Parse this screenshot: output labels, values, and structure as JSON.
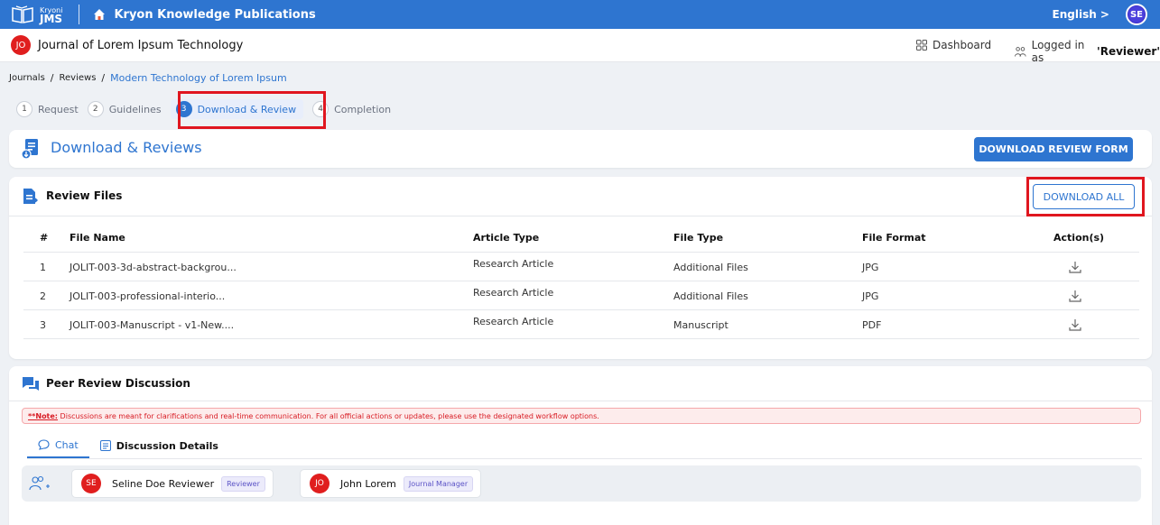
{
  "app": {
    "brand_small": "Kryoni",
    "brand_big": "JMS",
    "publisher": "Kryon Knowledge Publications",
    "language": "English >",
    "user_initials": "SE"
  },
  "journal": {
    "initials": "JO",
    "title": "Journal of Lorem Ipsum Technology",
    "dashboard_label": "Dashboard",
    "logged_prefix": "Logged in as",
    "logged_role": "'Reviewer'"
  },
  "breadcrumb": {
    "items": [
      "Journals",
      "Reviews"
    ],
    "separator": "/",
    "current": "Modern Technology of Lorem Ipsum"
  },
  "stepper": [
    {
      "num": "1",
      "label": "Request"
    },
    {
      "num": "2",
      "label": "Guidelines"
    },
    {
      "num": "3",
      "label": "Download & Review"
    },
    {
      "num": "4",
      "label": "Completion"
    }
  ],
  "download_section": {
    "title": "Download & Reviews",
    "button": "DOWNLOAD REVIEW FORM"
  },
  "review_files": {
    "title": "Review Files",
    "download_all": "DOWNLOAD ALL",
    "columns": [
      "#",
      "File Name",
      "Article Type",
      "File Type",
      "File Format",
      "Action(s)"
    ],
    "rows": [
      {
        "num": "1",
        "name": "JOLIT-003-3d-abstract-backgrou...",
        "article_type": "Research Article",
        "file_type": "Additional Files",
        "format": "JPG"
      },
      {
        "num": "2",
        "name": "JOLIT-003-professional-interio...",
        "article_type": "Research Article",
        "file_type": "Additional Files",
        "format": "JPG"
      },
      {
        "num": "3",
        "name": "JOLIT-003-Manuscript - v1-New....",
        "article_type": "Research Article",
        "file_type": "Manuscript",
        "format": "PDF"
      }
    ]
  },
  "discussion": {
    "title": "Peer Review Discussion",
    "note_prefix": "**Note:",
    "note_text": " Discussions are meant for clarifications and real-time communication. For all official actions or updates, please use the designated workflow options.",
    "tabs": [
      "Chat",
      "Discussion Details"
    ],
    "participants": [
      {
        "initials": "SE",
        "name": "Seline Doe Reviewer",
        "role": "Reviewer"
      },
      {
        "initials": "JO",
        "name": "John Lorem",
        "role": "Journal Manager"
      }
    ]
  },
  "colors": {
    "accent": "#2e75d0",
    "highlight": "#e0161f",
    "avatar": "#e01e1e"
  }
}
